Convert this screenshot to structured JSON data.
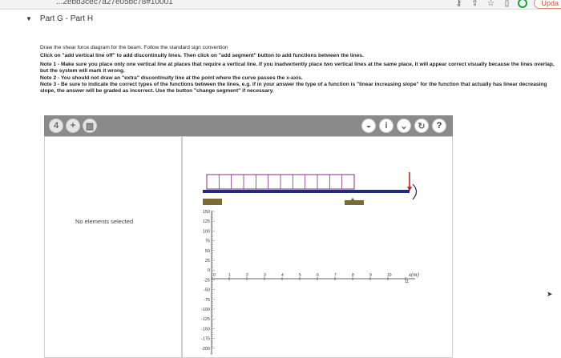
{
  "browser": {
    "url_fragment": "...2ebb3cec7a27e05bc78#10001",
    "update_label": "Upda"
  },
  "part": {
    "title": "Part G - Part H"
  },
  "instructions": {
    "intro": "Draw the shear force diagram for the beam. Follow the standard sign convention",
    "click_line": "Click on \"add vertical line off\" to add discontinuity lines. Then click on \"add segment\" button to add functions between the lines.",
    "note1": "Note 1 - Make sure you place only one vertical line at places that require a vertical line. If you inadvertently place two vertical lines at the same place, it will appear correct visually because the lines overlap, but the system will mark it wrong.",
    "note2": "Note 2 - You should not draw an \"extra\" discontinuity line at the point where the curve passes the x-axis.",
    "note3": "Note 3 - Be sure to indicate the correct types of the functions between the lines, e.g. if in your answer the type of a function is \"linear increasing slope\" for the function that actually has linear decreasing slope, the answer will be graded as incorrect. Use the button \"change segment\" if necessary."
  },
  "tool": {
    "left_panel_text": "No elements selected",
    "toolbar_left": [
      "4",
      "+",
      "trash"
    ],
    "toolbar_right": [
      "hint",
      "i",
      "chevron",
      "reset",
      "?"
    ],
    "x_axis_label": "x(m)",
    "y_ticks": [
      "150",
      "125",
      "100",
      "75",
      "50",
      "25",
      "0",
      "-25",
      "-50",
      "-75",
      "-100",
      "-125",
      "-150",
      "-175",
      "-200"
    ],
    "x_ticks": [
      "0",
      "1",
      "2",
      "3",
      "4",
      "5",
      "6",
      "7",
      "8",
      "9",
      "10",
      "11"
    ],
    "colors": {
      "beam": "#1f2d7a",
      "load": "#8a2d8a",
      "support": "#7a6a3a",
      "point_load": "#d62020",
      "toolbar": "#8a8a8a"
    }
  }
}
